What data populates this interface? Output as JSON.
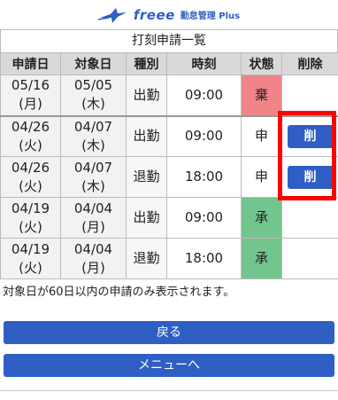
{
  "header": {
    "logo_text": "freee",
    "logo_sub": "勤怠管理 Plus"
  },
  "list": {
    "title": "打刻申請一覧",
    "columns": [
      "申請日",
      "対象日",
      "種別",
      "時刻",
      "状態",
      "削除"
    ],
    "rows": [
      {
        "apply_date": "05/16",
        "apply_day": "(月)",
        "target_date": "05/05",
        "target_day": "(木)",
        "type": "出勤",
        "time": "09:00",
        "status": "棄",
        "status_kind": "rejected",
        "delete_label": ""
      },
      {
        "apply_date": "04/26",
        "apply_day": "(火)",
        "target_date": "04/07",
        "target_day": "(木)",
        "type": "出勤",
        "time": "09:00",
        "status": "申",
        "status_kind": "pending",
        "delete_label": "削"
      },
      {
        "apply_date": "04/26",
        "apply_day": "(火)",
        "target_date": "04/07",
        "target_day": "(木)",
        "type": "退勤",
        "time": "18:00",
        "status": "申",
        "status_kind": "pending",
        "delete_label": "削"
      },
      {
        "apply_date": "04/19",
        "apply_day": "(火)",
        "target_date": "04/04",
        "target_day": "(月)",
        "type": "出勤",
        "time": "09:00",
        "status": "承",
        "status_kind": "approved",
        "delete_label": ""
      },
      {
        "apply_date": "04/19",
        "apply_day": "(火)",
        "target_date": "04/04",
        "target_day": "(月)",
        "type": "退勤",
        "time": "18:00",
        "status": "承",
        "status_kind": "approved",
        "delete_label": ""
      }
    ]
  },
  "note": "対象日が60日以内の申請のみ表示されます。",
  "buttons": {
    "back": "戻る",
    "menu": "メニューへ"
  },
  "colors": {
    "accent": "#2f5fc4",
    "rejected": "#f08488",
    "approved": "#72c58d",
    "highlight": "#ff0000"
  }
}
